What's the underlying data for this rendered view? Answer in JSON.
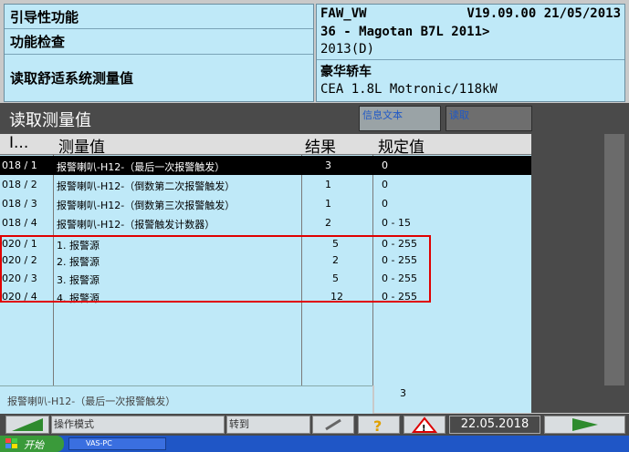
{
  "header": {
    "left": {
      "line1": "引导性功能",
      "line2": "功能检查",
      "line3": "读取舒适系统测量值"
    },
    "right": {
      "brand": "FAW_VW",
      "version": "V19.09.00 21/05/2013",
      "model": "36 - Magotan B7L 2011>",
      "year": "2013(D)",
      "body": "豪华轿车",
      "engine": "CEA 1.8L Motronic/118kW"
    }
  },
  "band": {
    "title": "读取测量值",
    "tab_info": "信息文本",
    "tab_read": "读取"
  },
  "table": {
    "headers": {
      "id": "I...",
      "name": "测量值",
      "result": "结果",
      "spec": "规定值"
    },
    "rows": [
      {
        "id": "018 / 1",
        "name": "报警喇叭-H12-（最后一次报警触发）",
        "result": "3",
        "spec": "0"
      },
      {
        "id": "018 / 2",
        "name": "报警喇叭-H12-（倒数第二次报警触发）",
        "result": "1",
        "spec": "0"
      },
      {
        "id": "018 / 3",
        "name": "报警喇叭-H12-（倒数第三次报警触发）",
        "result": "1",
        "spec": "0"
      },
      {
        "id": "018 / 4",
        "name": "报警喇叭-H12-（报警触发计数器）",
        "result": "2",
        "spec": "0 - 15"
      },
      {
        "id": "020 / 1",
        "name": "1. 报警源",
        "result": "5",
        "spec": "0 - 255"
      },
      {
        "id": "020 / 2",
        "name": "2. 报警源",
        "result": "2",
        "spec": "0 - 255"
      },
      {
        "id": "020 / 3",
        "name": "3. 报警源",
        "result": "5",
        "spec": "0 - 255"
      },
      {
        "id": "020 / 4",
        "name": "4. 报警源",
        "result": "12",
        "spec": "0 - 255"
      }
    ]
  },
  "status": {
    "label": "报警喇叭-H12-（最后一次报警触发）",
    "value": "3"
  },
  "bottom": {
    "mode": "操作模式",
    "goto": "转到",
    "date": "22.05.2018"
  },
  "taskbar": {
    "start": "开始",
    "task": "VAS-PC"
  },
  "colors": {
    "panel": "#bfe9f8",
    "dark": "#4a4a4a",
    "highlight": "#e00000"
  }
}
